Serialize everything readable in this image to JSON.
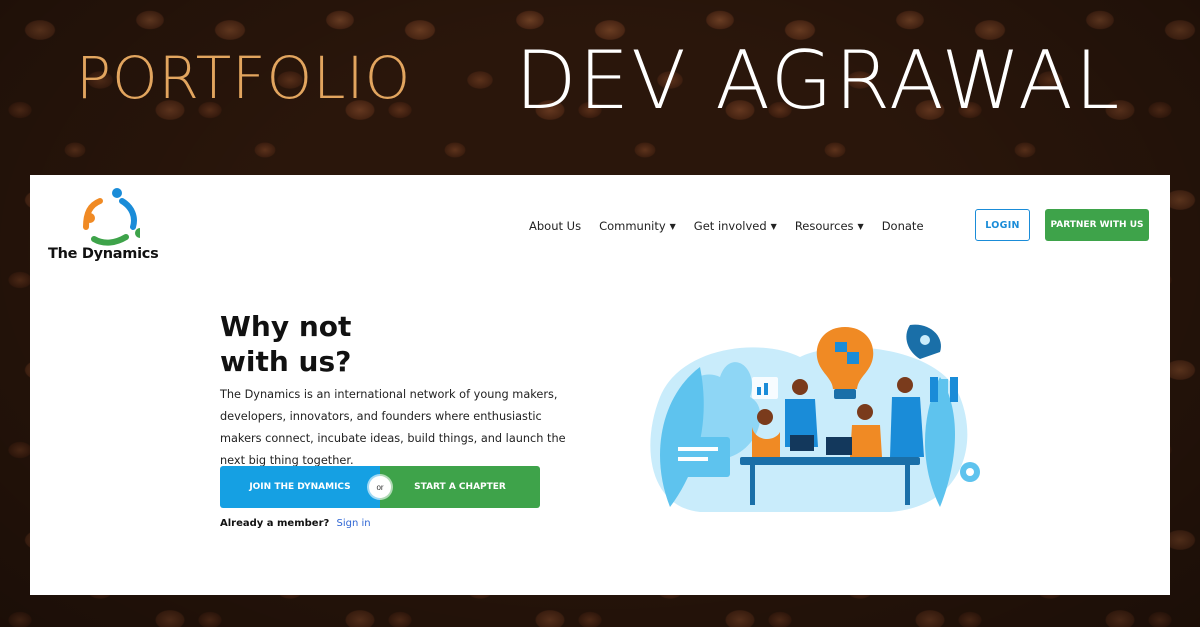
{
  "banner": {
    "portfolio": "PORTFOLIO",
    "name": "DEV AGRAWAL"
  },
  "site": {
    "logo_text": "The Dynamics",
    "nav": [
      {
        "label": "About Us",
        "dropdown": false
      },
      {
        "label": "Community",
        "dropdown": true
      },
      {
        "label": "Get involved",
        "dropdown": true
      },
      {
        "label": "Resources",
        "dropdown": true
      },
      {
        "label": "Donate",
        "dropdown": false
      }
    ],
    "login_label": "LOGIN",
    "partner_label": "PARTNER WITH US"
  },
  "hero": {
    "title_line1": "Why not",
    "title_line2": "with us?",
    "description": "The Dynamics is an international network of young makers, developers, innovators, and founders where enthusiastic makers connect, incubate ideas, build things, and launch the next big thing together.",
    "join_label": "JOIN THE DYNAMICS",
    "or_label": "or",
    "chapter_label": "START A CHAPTER",
    "member_question": "Already a member?",
    "signin_label": "Sign in"
  },
  "colors": {
    "accent_blue": "#15a0e3",
    "accent_green": "#3ea34a",
    "portfolio_gold": "#e2a55f",
    "link_blue": "#2f66d4"
  }
}
